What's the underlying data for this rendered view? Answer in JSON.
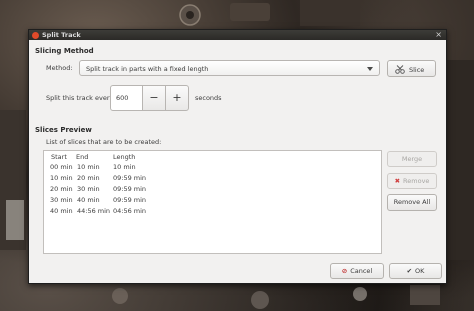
{
  "window": {
    "title": "Split Track"
  },
  "slicing": {
    "heading": "Slicing Method",
    "method_label": "Method:",
    "method_value": "Split track in parts with a fixed length",
    "slice_button": "Slice",
    "split_prefix": "Split this track every",
    "split_value": "600",
    "split_suffix": "seconds",
    "minus": "−",
    "plus": "+"
  },
  "preview": {
    "heading": "Slices Preview",
    "list_label": "List of slices that are to be created:",
    "columns": [
      "Start",
      "End",
      "Length"
    ],
    "rows": [
      [
        "00 min",
        "10 min",
        "10 min"
      ],
      [
        "10 min",
        "20 min",
        "09:59 min"
      ],
      [
        "20 min",
        "30 min",
        "09:59 min"
      ],
      [
        "30 min",
        "40 min",
        "09:59 min"
      ],
      [
        "40 min",
        "44:56 min",
        "04:56 min"
      ]
    ],
    "merge_button": "Merge",
    "remove_button": "Remove",
    "remove_all_button": "Remove All"
  },
  "footer": {
    "cancel": "Cancel",
    "ok": "OK"
  },
  "colors": {
    "title_icon": "#e04a2a",
    "remove_x": "#d04040",
    "ok_check": "#3c3c3c"
  },
  "icons": [
    "app-icon",
    "close-icon",
    "dropdown-arrow-icon",
    "scissors-icon",
    "remove-x-icon",
    "cancel-icon",
    "ok-check-icon"
  ]
}
